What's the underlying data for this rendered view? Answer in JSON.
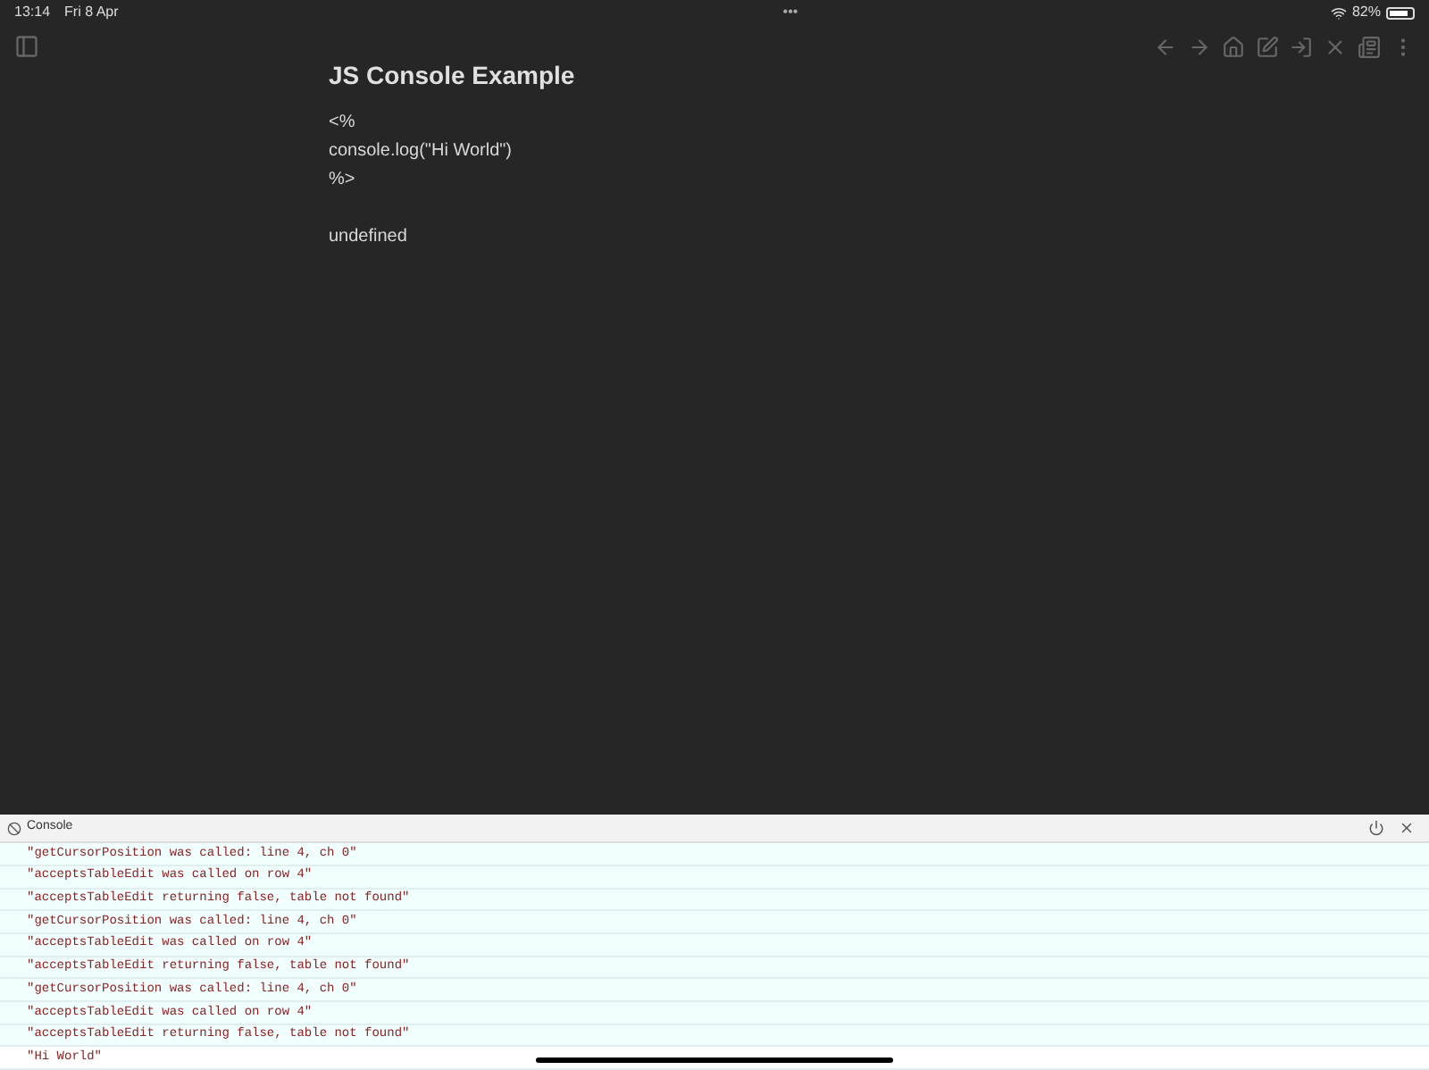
{
  "status_bar": {
    "time": "13:14",
    "date": "Fri 8 Apr",
    "dots": "•••",
    "battery": "82%"
  },
  "note": {
    "title": "JS Console Example",
    "code_lines": [
      "<%",
      "console.log(\"Hi World\")",
      "%>"
    ],
    "output": "undefined"
  },
  "console": {
    "title": "Console",
    "rows": [
      {
        "text": "\"getCursorPosition was called: line 4, ch 0\"",
        "highlighted": false
      },
      {
        "text": "\"acceptsTableEdit was called on row 4\"",
        "highlighted": false
      },
      {
        "text": "\"acceptsTableEdit returning false, table not found\"",
        "highlighted": false
      },
      {
        "text": "\"getCursorPosition was called: line 4, ch 0\"",
        "highlighted": false
      },
      {
        "text": "\"acceptsTableEdit was called on row 4\"",
        "highlighted": false
      },
      {
        "text": "\"acceptsTableEdit returning false, table not found\"",
        "highlighted": false
      },
      {
        "text": "\"getCursorPosition was called: line 4, ch 0\"",
        "highlighted": false
      },
      {
        "text": "\"acceptsTableEdit was called on row 4\"",
        "highlighted": false
      },
      {
        "text": "\"acceptsTableEdit returning false, table not found\"",
        "highlighted": false
      },
      {
        "text": "\"Hi World\"",
        "highlighted": true
      }
    ]
  }
}
